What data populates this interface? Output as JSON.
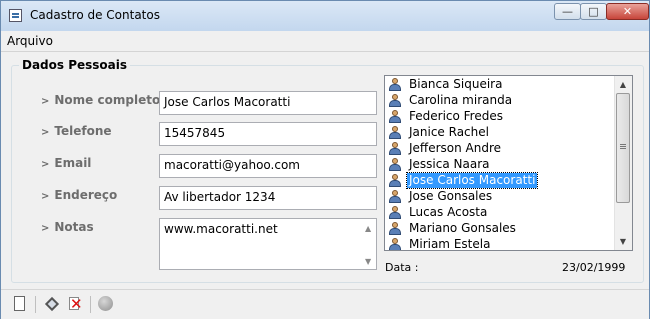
{
  "window": {
    "title": "Cadastro de Contatos"
  },
  "menu": {
    "items": [
      "Arquivo"
    ]
  },
  "group": {
    "title": "Dados Pessoais"
  },
  "fields": {
    "nome": {
      "label": "Nome completo",
      "value": "Jose Carlos Macoratti"
    },
    "telefone": {
      "label": "Telefone",
      "value": "15457845"
    },
    "email": {
      "label": "Email",
      "value": "macoratti@yahoo.com"
    },
    "endereco": {
      "label": "Endereço",
      "value": "Av libertador 1234"
    },
    "notas": {
      "label": "Notas",
      "value": "www.macoratti.net"
    }
  },
  "contacts": {
    "items": [
      "Bianca Siqueira",
      "Carolina miranda",
      "Federico Fredes",
      "Janice Rachel",
      "Jefferson Andre",
      "Jessica Naara",
      "Jose Carlos Macoratti",
      "Jose Gonsales",
      "Lucas Acosta",
      "Mariano Gonsales",
      "Miriam Estela"
    ],
    "selected": "Jose Carlos Macoratti"
  },
  "info": {
    "data_label": "Data :",
    "data_value": "23/02/1999"
  },
  "toolbar": {
    "icons": [
      "new-document-icon",
      "edit-icon",
      "delete-icon",
      "record-icon"
    ]
  },
  "colors": {
    "selection": "#3399ff",
    "label_gray": "#6d6d6d"
  }
}
